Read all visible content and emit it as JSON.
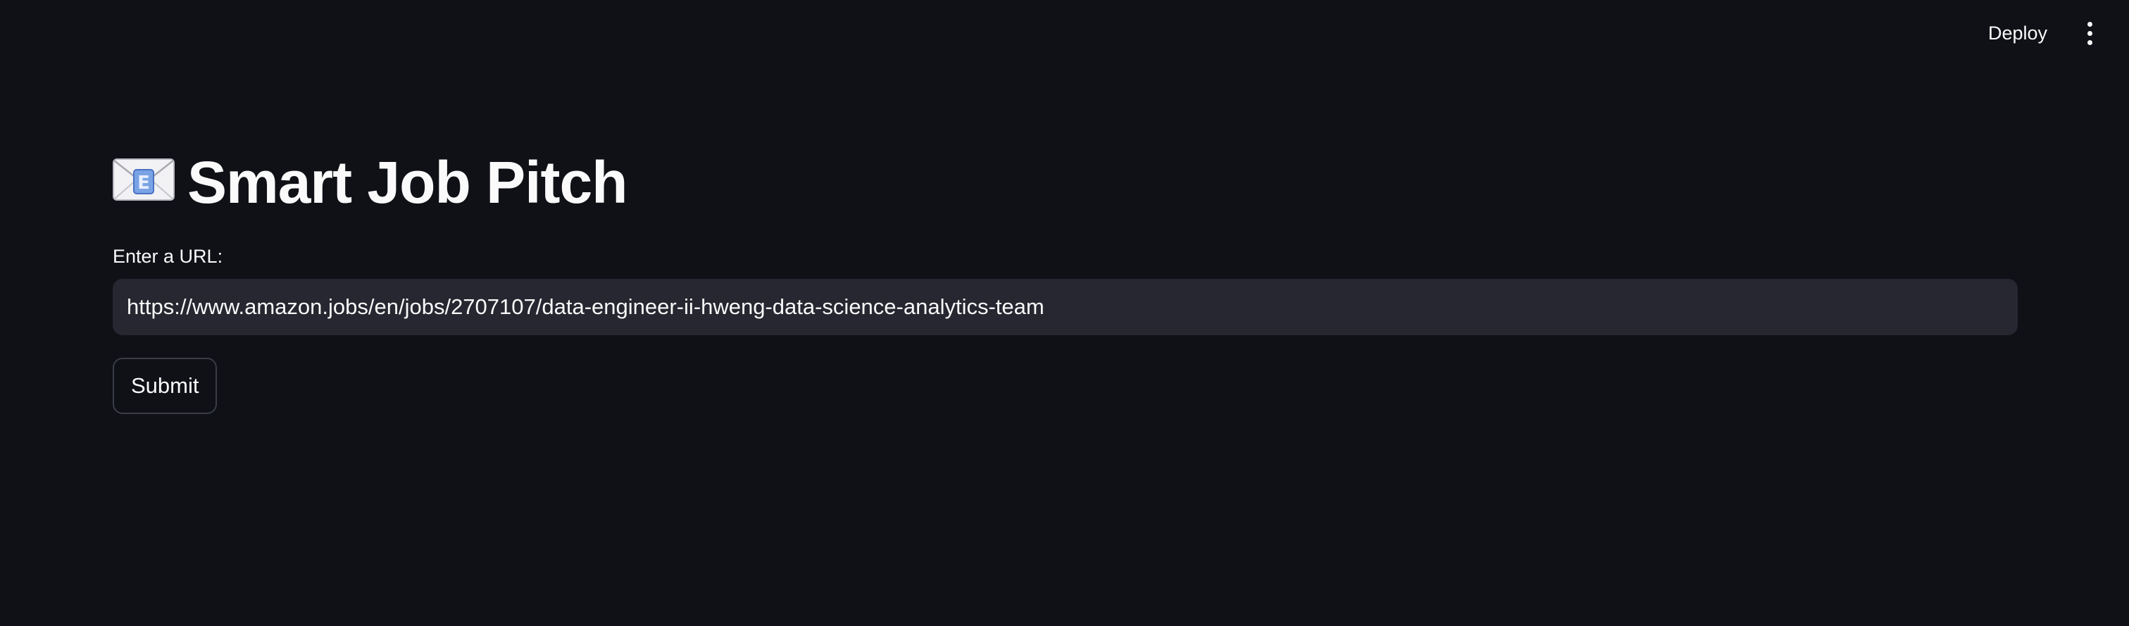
{
  "header": {
    "deploy_label": "Deploy",
    "menu_icon": "kebab-menu-icon"
  },
  "main": {
    "title_icon": "envelope-e-icon",
    "title": "Smart Job Pitch",
    "url_label": "Enter a URL:",
    "url_value": "https://www.amazon.jobs/en/jobs/2707107/data-engineer-ii-hweng-data-science-analytics-team",
    "submit_label": "Submit"
  },
  "colors": {
    "background": "#0f1117",
    "input_background": "#262730",
    "text": "#fafafa",
    "button_border": "#3a3c46"
  }
}
